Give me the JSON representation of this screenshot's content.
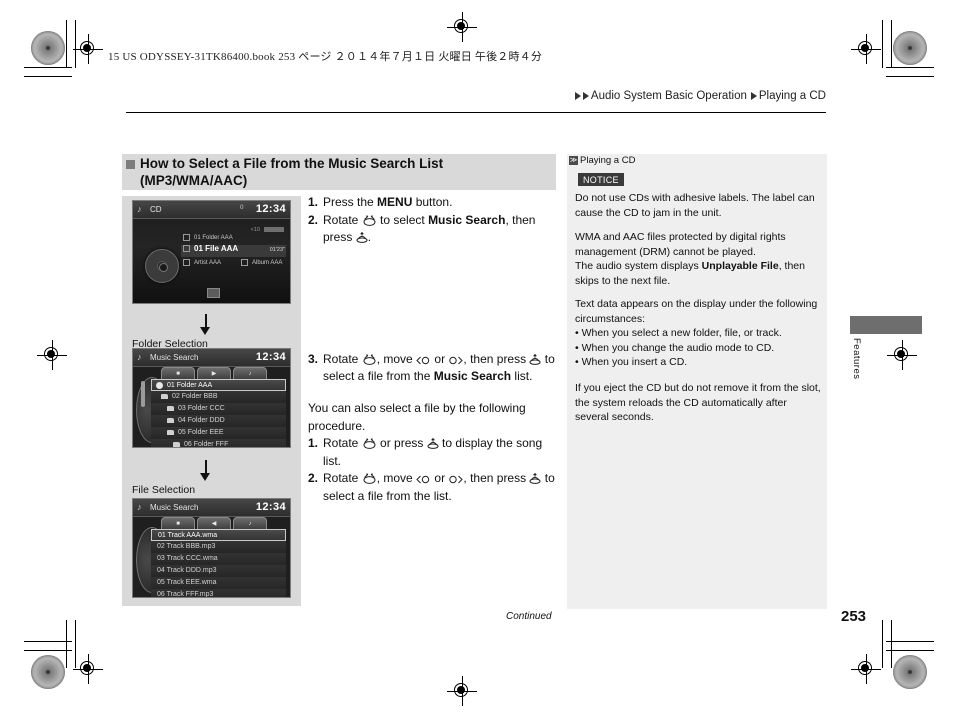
{
  "print": {
    "slugline": "15 US ODYSSEY-31TK86400.book   253 ページ   ２０１４年７月１日   火曜日   午後２時４分"
  },
  "breadcrumb": {
    "section": "Audio System Basic Operation",
    "topic": "Playing a CD"
  },
  "heading": {
    "line1": "How to Select a File from the Music Search List",
    "line2": "(MP3/WMA/AAC)"
  },
  "figures": {
    "screen_cd": {
      "title": "CD",
      "clock": "12:34",
      "status": "0",
      "track_progress": "<10",
      "rows": [
        {
          "label": "01  Folder AAA",
          "time": ""
        },
        {
          "label": "01 File AAA",
          "time": "01'23\""
        },
        {
          "label": "Artist AAA",
          "time": ""
        },
        {
          "label": "Album AAA",
          "time": ""
        }
      ]
    },
    "caption_folder": "Folder Selection",
    "screen_folder": {
      "title": "Music Search",
      "clock": "12:34",
      "items": [
        "01 Folder AAA",
        "02 Folder BBB",
        "03 Folder CCC",
        "04 Folder DDD",
        "05 Folder EEE",
        "06 Folder FFF"
      ]
    },
    "caption_file": "File Selection",
    "screen_file": {
      "title": "Music Search",
      "clock": "12:34",
      "items": [
        "01 Track AAA.wma",
        "02 Track BBB.mp3",
        "03 Track CCC.wma",
        "04 Track DDD.mp3",
        "05 Track EEE.wma",
        "06 Track FFF.mp3"
      ]
    }
  },
  "steps": {
    "s1_num": "1.",
    "s1_a": "Press the ",
    "s1_b": "MENU",
    "s1_c": " button.",
    "s2_num": "2.",
    "s2_a": "Rotate ",
    "s2_b": " to select ",
    "s2_c": "Music Search",
    "s2_d": ", then press ",
    "s2_e": ".",
    "s3_num": "3.",
    "s3_a": "Rotate ",
    "s3_b": ", move ",
    "s3_c": " or ",
    "s3_d": ", then press ",
    "s3_e": " to select a file from the ",
    "s3_f": "Music Search",
    "s3_g": " list."
  },
  "alt": {
    "intro": "You can also select a file by the following procedure.",
    "a1_num": "1.",
    "a1_a": "Rotate ",
    "a1_b": " or press ",
    "a1_c": " to display the song list.",
    "a2_num": "2.",
    "a2_a": "Rotate ",
    "a2_b": ", move ",
    "a2_c": " or ",
    "a2_d": ", then press ",
    "a2_e": " to select a file from the list."
  },
  "sidebar": {
    "marker": "≫",
    "title": "Playing a CD",
    "notice_label": "NOTICE",
    "p1": "Do not use CDs with adhesive labels. The label can cause the CD to jam in the unit.",
    "p2a": "WMA and AAC files protected by digital rights management (DRM) cannot be played.",
    "p2b_pre": "The audio system displays ",
    "p2b_bold": "Unplayable File",
    "p2b_post": ", then skips to the next file.",
    "p3": "Text data appears on the display under the following circumstances:",
    "bullets": [
      "When you select a new folder, file, or track.",
      "When you change the audio mode to CD.",
      "When you insert a CD."
    ],
    "p4": "If you eject the CD but do not remove it from the slot, the system reloads the CD automatically after several seconds."
  },
  "footer": {
    "continued": "Continued",
    "page": "253",
    "thumb_label": "Features"
  }
}
